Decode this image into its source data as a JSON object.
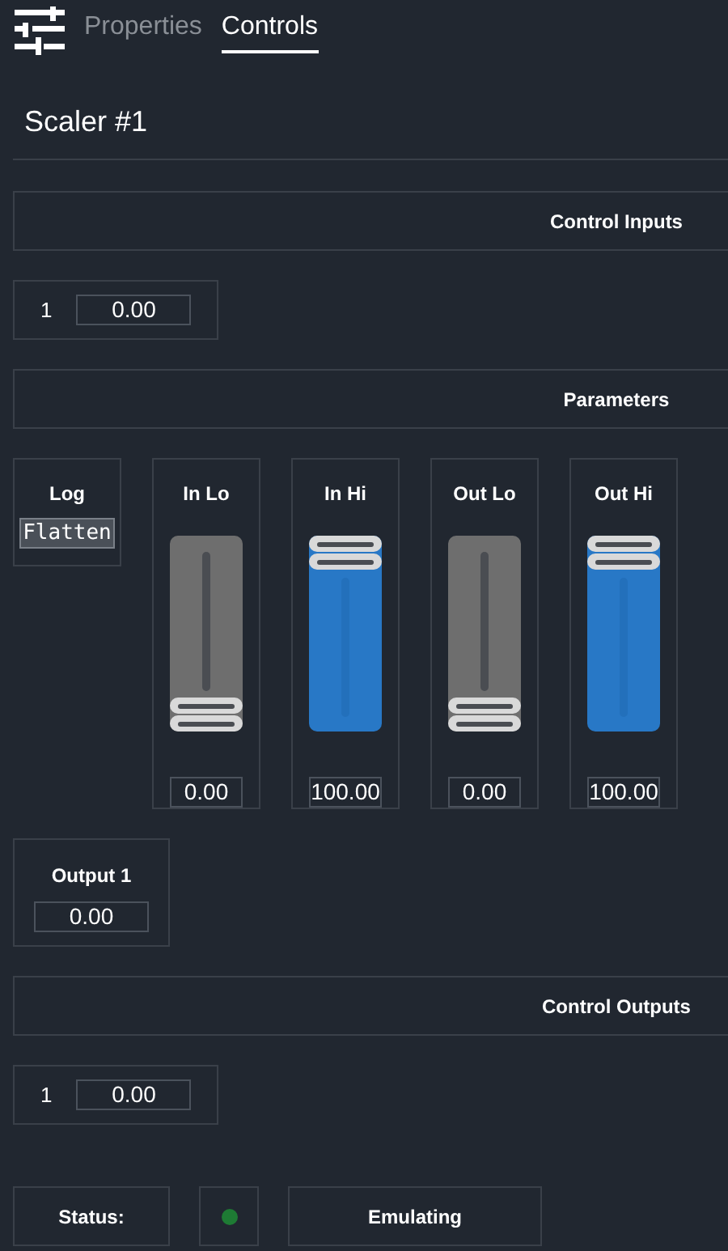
{
  "tabs": [
    {
      "label": "Properties",
      "selected": false
    },
    {
      "label": "Controls",
      "selected": true
    }
  ],
  "title": "Scaler #1",
  "control_inputs": {
    "heading": "Control Inputs",
    "rows": [
      {
        "label": "1",
        "value": "0.00"
      }
    ]
  },
  "parameters": {
    "heading": "Parameters",
    "log": {
      "label": "Log",
      "button": "Flatten"
    },
    "sliders": [
      {
        "label": "In Lo",
        "at_max": false,
        "value": "0.00"
      },
      {
        "label": "In Hi",
        "at_max": true,
        "value": "100.00"
      },
      {
        "label": "Out Lo",
        "at_max": false,
        "value": "0.00"
      },
      {
        "label": "Out Hi",
        "at_max": true,
        "value": "100.00"
      }
    ],
    "output": {
      "label": "Output 1",
      "value": "0.00"
    }
  },
  "control_outputs": {
    "heading": "Control Outputs",
    "rows": [
      {
        "label": "1",
        "value": "0.00"
      }
    ]
  },
  "status": {
    "label": "Status:",
    "led_on": true,
    "text": "Emulating"
  }
}
